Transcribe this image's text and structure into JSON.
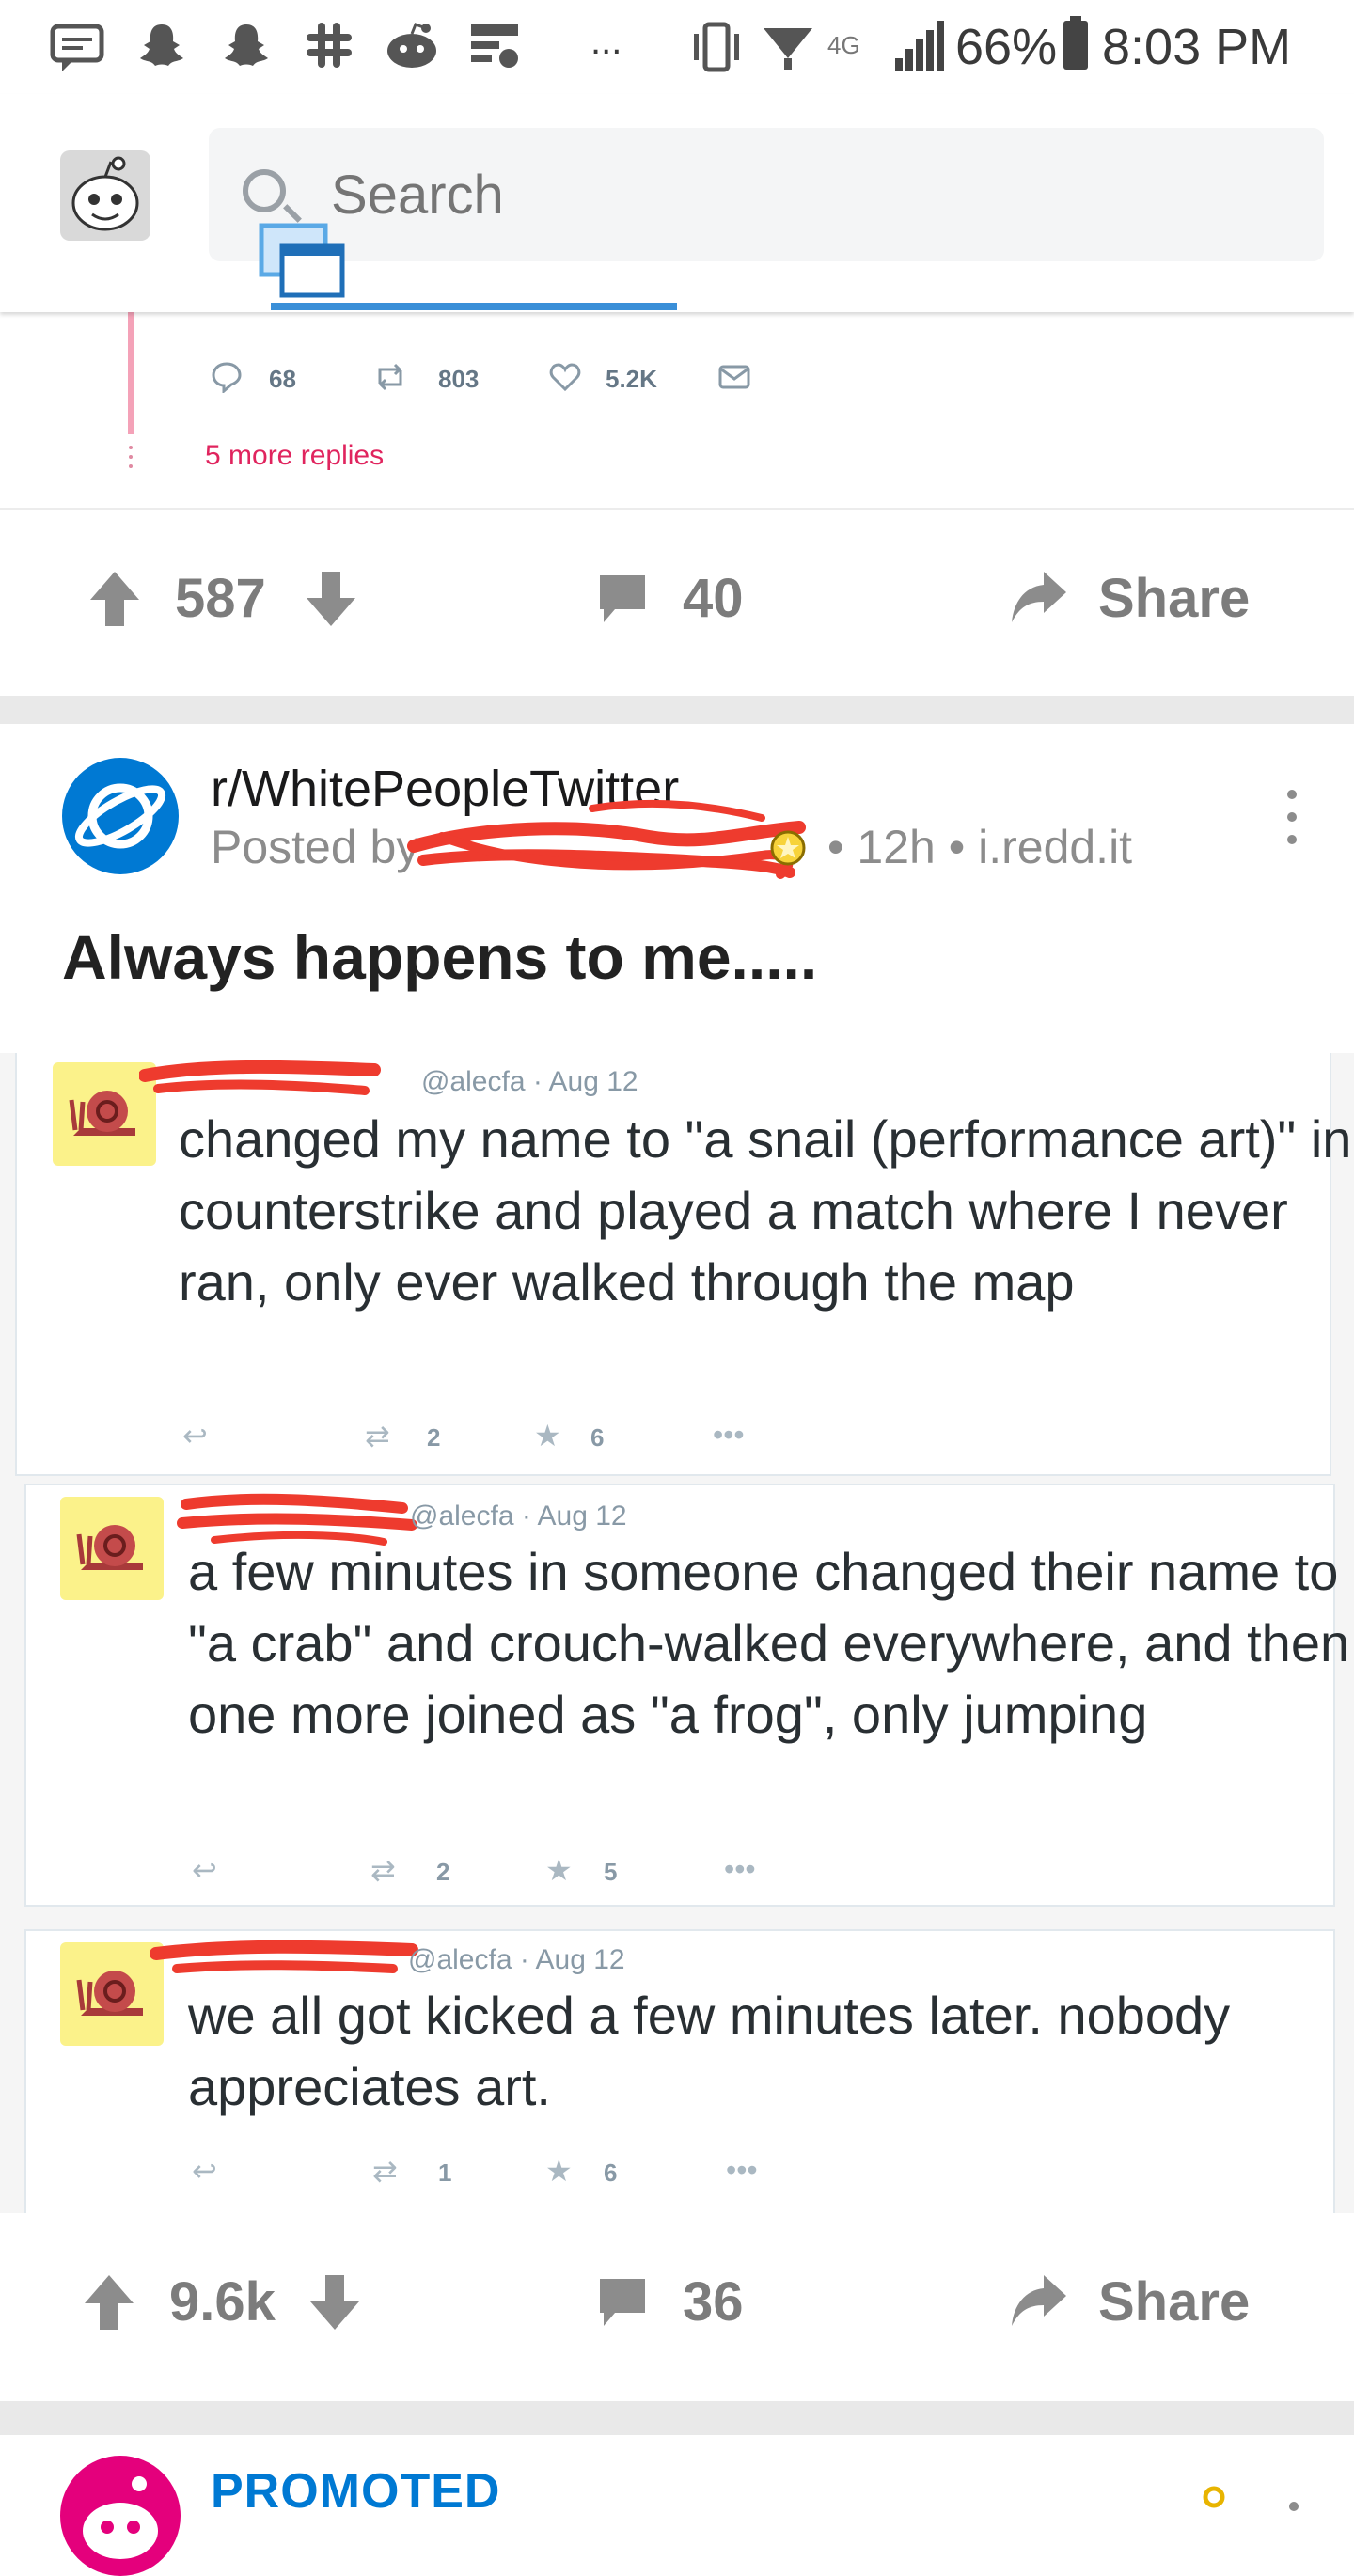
{
  "status_bar": {
    "battery": "66%",
    "time": "8:03 PM",
    "network": "4G",
    "more": "..."
  },
  "header": {
    "search_placeholder": "Search"
  },
  "previous_post": {
    "tweet_actions": {
      "replies": "68",
      "retweets": "803",
      "likes": "5.2K"
    },
    "more_replies": "5 more replies",
    "score": "587",
    "comments": "40",
    "share_label": "Share"
  },
  "post": {
    "subreddit": "r/WhitePeopleTwitter",
    "posted_by": "Posted by",
    "meta": "• 12h • i.redd.it",
    "title": "Always happens to me.....",
    "image": {
      "tweets": [
        {
          "handle": "@alecfa · Aug 12",
          "text": "changed my name to \"a snail (performance art)\" in counterstrike and played a match where I never ran, only ever walked through the map",
          "retweets": "2",
          "favorites": "6"
        },
        {
          "handle": "@alecfa · Aug 12",
          "text": "a few minutes in someone changed their name to \"a crab\" and crouch-walked everywhere, and then one more joined as \"a frog\", only jumping",
          "retweets": "2",
          "favorites": "5"
        },
        {
          "handle": "@alecfa · Aug 12",
          "text": "we all got kicked a few minutes later. nobody appreciates art.",
          "retweets": "1",
          "favorites": "6"
        }
      ]
    },
    "score": "9.6k",
    "comments": "36",
    "share_label": "Share"
  },
  "next_post": {
    "label": "PROMOTED"
  },
  "colors": {
    "accent_blue": "#0079d3",
    "vote_grey": "#7c7c7c",
    "promoted_pink": "#e4007c",
    "scribble_red": "#ee3b2e"
  }
}
